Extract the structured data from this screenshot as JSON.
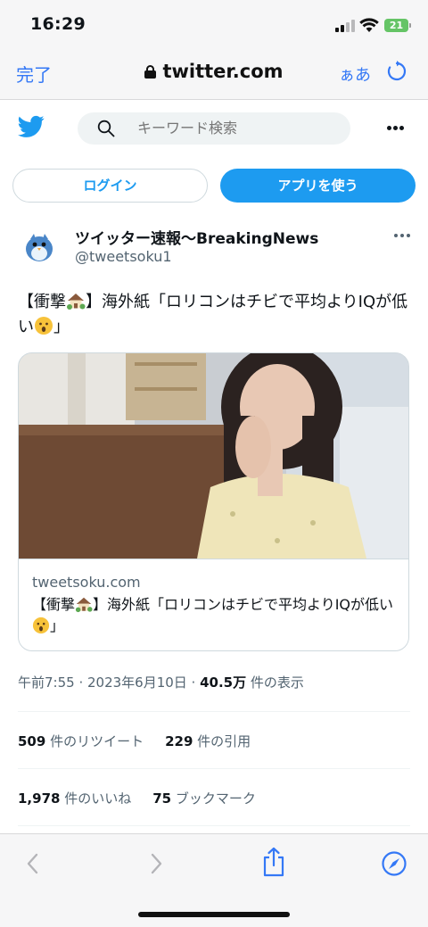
{
  "status_bar": {
    "time": "16:29",
    "battery": "21",
    "battery_color": "#65c466"
  },
  "safari": {
    "done_label": "完了",
    "url": "twitter.com",
    "aa_label": "ぁあ",
    "accent_color": "#3478f6"
  },
  "twitter_header": {
    "search_placeholder": "キーワード検索",
    "brand_color": "#1d9bf0"
  },
  "buttons": {
    "login_label": "ログイン",
    "app_label": "アプリを使う"
  },
  "tweet": {
    "display_name": "ツイッター速報〜BreakingNews",
    "handle": "@tweetsoku1",
    "text_part1": "【衝撃",
    "text_part2": "】海外紙「ロリコンはチビで平均よりIQが低い",
    "text_part3": "」",
    "card": {
      "domain": "tweetsoku.com",
      "title_part1": "【衝撃",
      "title_part2": "】海外紙「ロリコンはチビで平均よりIQが低い",
      "title_part3": "」"
    },
    "timestamp": "午前7:55 · 2023年6月10日 · ",
    "views_count": "40.5万",
    "views_label": " 件の表示",
    "retweets_count": "509",
    "retweets_label": " 件のリツイート",
    "quotes_count": "229",
    "quotes_label": " 件の引用",
    "likes_count": "1,978",
    "likes_label": " 件のいいね",
    "bookmarks_count": "75",
    "bookmarks_label": " ブックマーク"
  },
  "icons": {
    "back": "chevron-left-icon",
    "forward": "chevron-right-icon",
    "share": "share-icon",
    "compass": "compass-icon",
    "reload": "reload-icon",
    "lock": "lock-icon",
    "search": "search-icon",
    "more": "more-icon",
    "house_emoji": "house-emoji-icon",
    "surprised_emoji": "surprised-emoji-icon"
  }
}
